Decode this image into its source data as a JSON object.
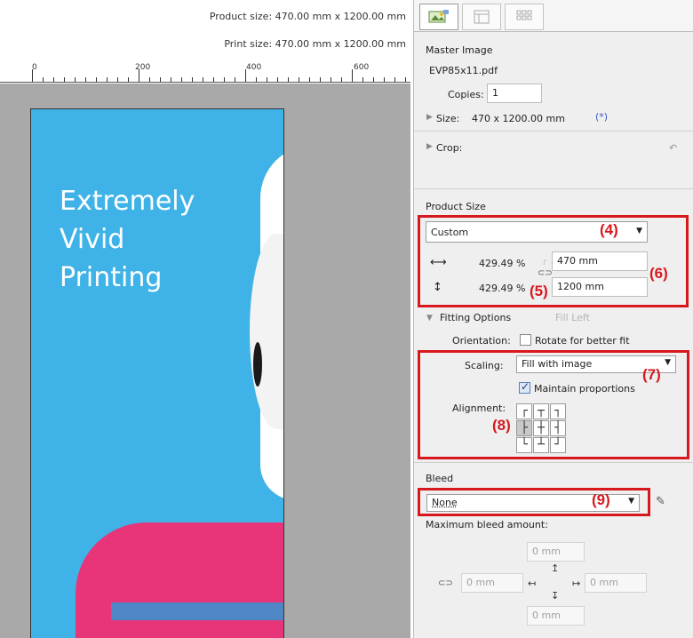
{
  "canvas": {
    "product_size": "Product size: 470.00 mm x 1200.00 mm",
    "print_size": "Print size: 470.00 mm x 1200.00 mm",
    "ruler_labels": [
      "0",
      "200",
      "400",
      "600"
    ],
    "poster_lines": [
      "Extremely",
      "Vivid",
      "Printing"
    ]
  },
  "tabs": [
    {
      "icon": "image-layout-icon",
      "active": true
    },
    {
      "icon": "template-icon",
      "active": false
    },
    {
      "icon": "tile-grid-icon",
      "active": false
    }
  ],
  "master_image": {
    "title": "Master Image",
    "filename": "EVP85x11.pdf",
    "copies_label": "Copies:",
    "copies_value": "1",
    "size_label": "Size:",
    "size_value": "470 x 1200.00 mm",
    "size_marker": "(*)",
    "crop_label": "Crop:",
    "undo_icon": "undo-icon"
  },
  "product_size": {
    "title": "Product Size",
    "preset": "Custom",
    "width_percent": "429.49 %",
    "height_percent": "429.49 %",
    "width_value": "470 mm",
    "height_value": "1200 mm"
  },
  "fitting": {
    "title": "Fitting Options",
    "hint": "Fill Left",
    "orientation_label": "Orientation:",
    "rotate_label": "Rotate for better fit",
    "rotate_checked": false,
    "scaling_label": "Scaling:",
    "scaling_value": "Fill with image",
    "maintain_label": "Maintain proportions",
    "maintain_checked": true,
    "alignment_label": "Alignment:",
    "alignment_glyphs": [
      "┌",
      "┬",
      "┐",
      "├",
      "┼",
      "┤",
      "└",
      "┴",
      "┘"
    ],
    "alignment_selected": 3
  },
  "bleed": {
    "title": "Bleed",
    "value": "None",
    "max_label": "Maximum bleed amount:",
    "top": "0 mm",
    "left": "0 mm",
    "right": "0 mm",
    "bottom": "0 mm"
  },
  "annotations": {
    "a4": "(4)",
    "a5": "(5)",
    "a6": "(6)",
    "a7": "(7)",
    "a8": "(8)",
    "a9": "(9)"
  },
  "colors": {
    "annotation_red": "#d7191f",
    "poster_blue": "#3fb3e7",
    "shirt_pink": "#e8357a"
  }
}
